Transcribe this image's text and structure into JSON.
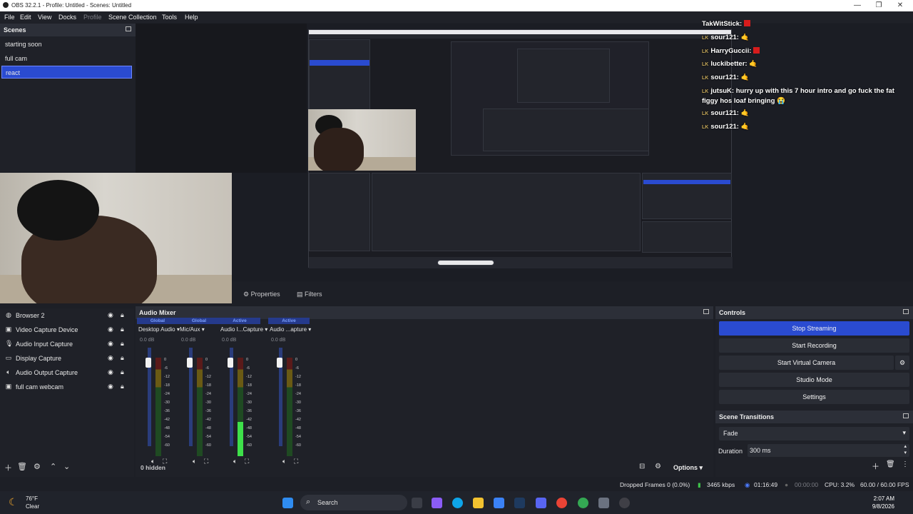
{
  "window": {
    "title": "OBS 32.2.1 - Profile: Untitled - Scenes: Untitled",
    "minimize": "—",
    "maximize": "❐",
    "close": "✕"
  },
  "menu": {
    "file": "File",
    "edit": "Edit",
    "view": "View",
    "docks": "Docks",
    "profile": "Profile",
    "scene_collection": "Scene Collection",
    "tools": "Tools",
    "help": "Help"
  },
  "scenes": {
    "title": "Scenes",
    "items": [
      {
        "label": "starting soon"
      },
      {
        "label": "full cam"
      },
      {
        "label": "react"
      }
    ],
    "selected": "react"
  },
  "chat": {
    "lines": [
      {
        "user": "TakWitStick:",
        "msg": ""
      },
      {
        "user": "sour121:",
        "msg": "🤙"
      },
      {
        "user": "HarryGuccii:",
        "msg": ""
      },
      {
        "user": "luckibetter:",
        "msg": "🤙"
      },
      {
        "user": "sour121:",
        "msg": "🤙"
      },
      {
        "user": "jutsuK:",
        "msg": "hurry up with this 7 hour intro and go fuck the fat"
      },
      {
        "user": "",
        "msg": "figgy hos loaf bringing 😭"
      },
      {
        "user": "sour121:",
        "msg": "🤙"
      },
      {
        "user": "sour121:",
        "msg": "🤙"
      }
    ],
    "badge": "LK"
  },
  "properties_bar": {
    "properties": "Properties",
    "filters": "Filters"
  },
  "sources": {
    "items": [
      {
        "label": "Browser 2",
        "icon": "globe-icon"
      },
      {
        "label": "Video Capture Device",
        "icon": "camera-icon"
      },
      {
        "label": "Audio Input Capture",
        "icon": "microphone-icon"
      },
      {
        "label": "Display Capture",
        "icon": "monitor-icon"
      },
      {
        "label": "Audio Output Capture",
        "icon": "speaker-icon"
      },
      {
        "label": "full cam webcam",
        "icon": "camera-icon"
      }
    ]
  },
  "mixer": {
    "title": "Audio Mixer",
    "hidden_label": "0 hidden",
    "options": "Options",
    "channels": [
      {
        "header": "Global",
        "name": "Desktop Audio",
        "db": "0.0 dB",
        "level": 0.0
      },
      {
        "header": "Global",
        "name": "Mic/Aux",
        "db": "0.0 dB",
        "level": 0.0
      },
      {
        "header": "Active",
        "name": "Audio I...Capture",
        "db": "0.0 dB",
        "level": 0.35
      },
      {
        "header": "Active",
        "name": "Audio ...apture",
        "db": "0.0 dB",
        "level": 0.0
      }
    ],
    "scale": [
      "0",
      "-6",
      "-12",
      "-18",
      "-24",
      "-30",
      "-36",
      "-42",
      "-48",
      "-54",
      "-60"
    ]
  },
  "controls": {
    "title": "Controls",
    "stop_streaming": "Stop Streaming",
    "start_recording": "Start Recording",
    "start_virtual_camera": "Start Virtual Camera",
    "studio_mode": "Studio Mode",
    "settings": "Settings"
  },
  "transitions": {
    "title": "Scene Transitions",
    "selected": "Fade",
    "duration_label": "Duration",
    "duration_value": "300 ms"
  },
  "status": {
    "dropped_frames": "Dropped Frames 0 (0.0%)",
    "bitrate": "3465 kbps",
    "stream_time": "01:16:49",
    "record_time": "00:00:00",
    "cpu": "CPU: 3.2%",
    "fps": "60.00 / 60.00 FPS"
  },
  "taskbar": {
    "temperature": "76°F",
    "weather": "Clear",
    "search": "Search",
    "time": "2:07 AM",
    "date": "9/8/2026"
  }
}
